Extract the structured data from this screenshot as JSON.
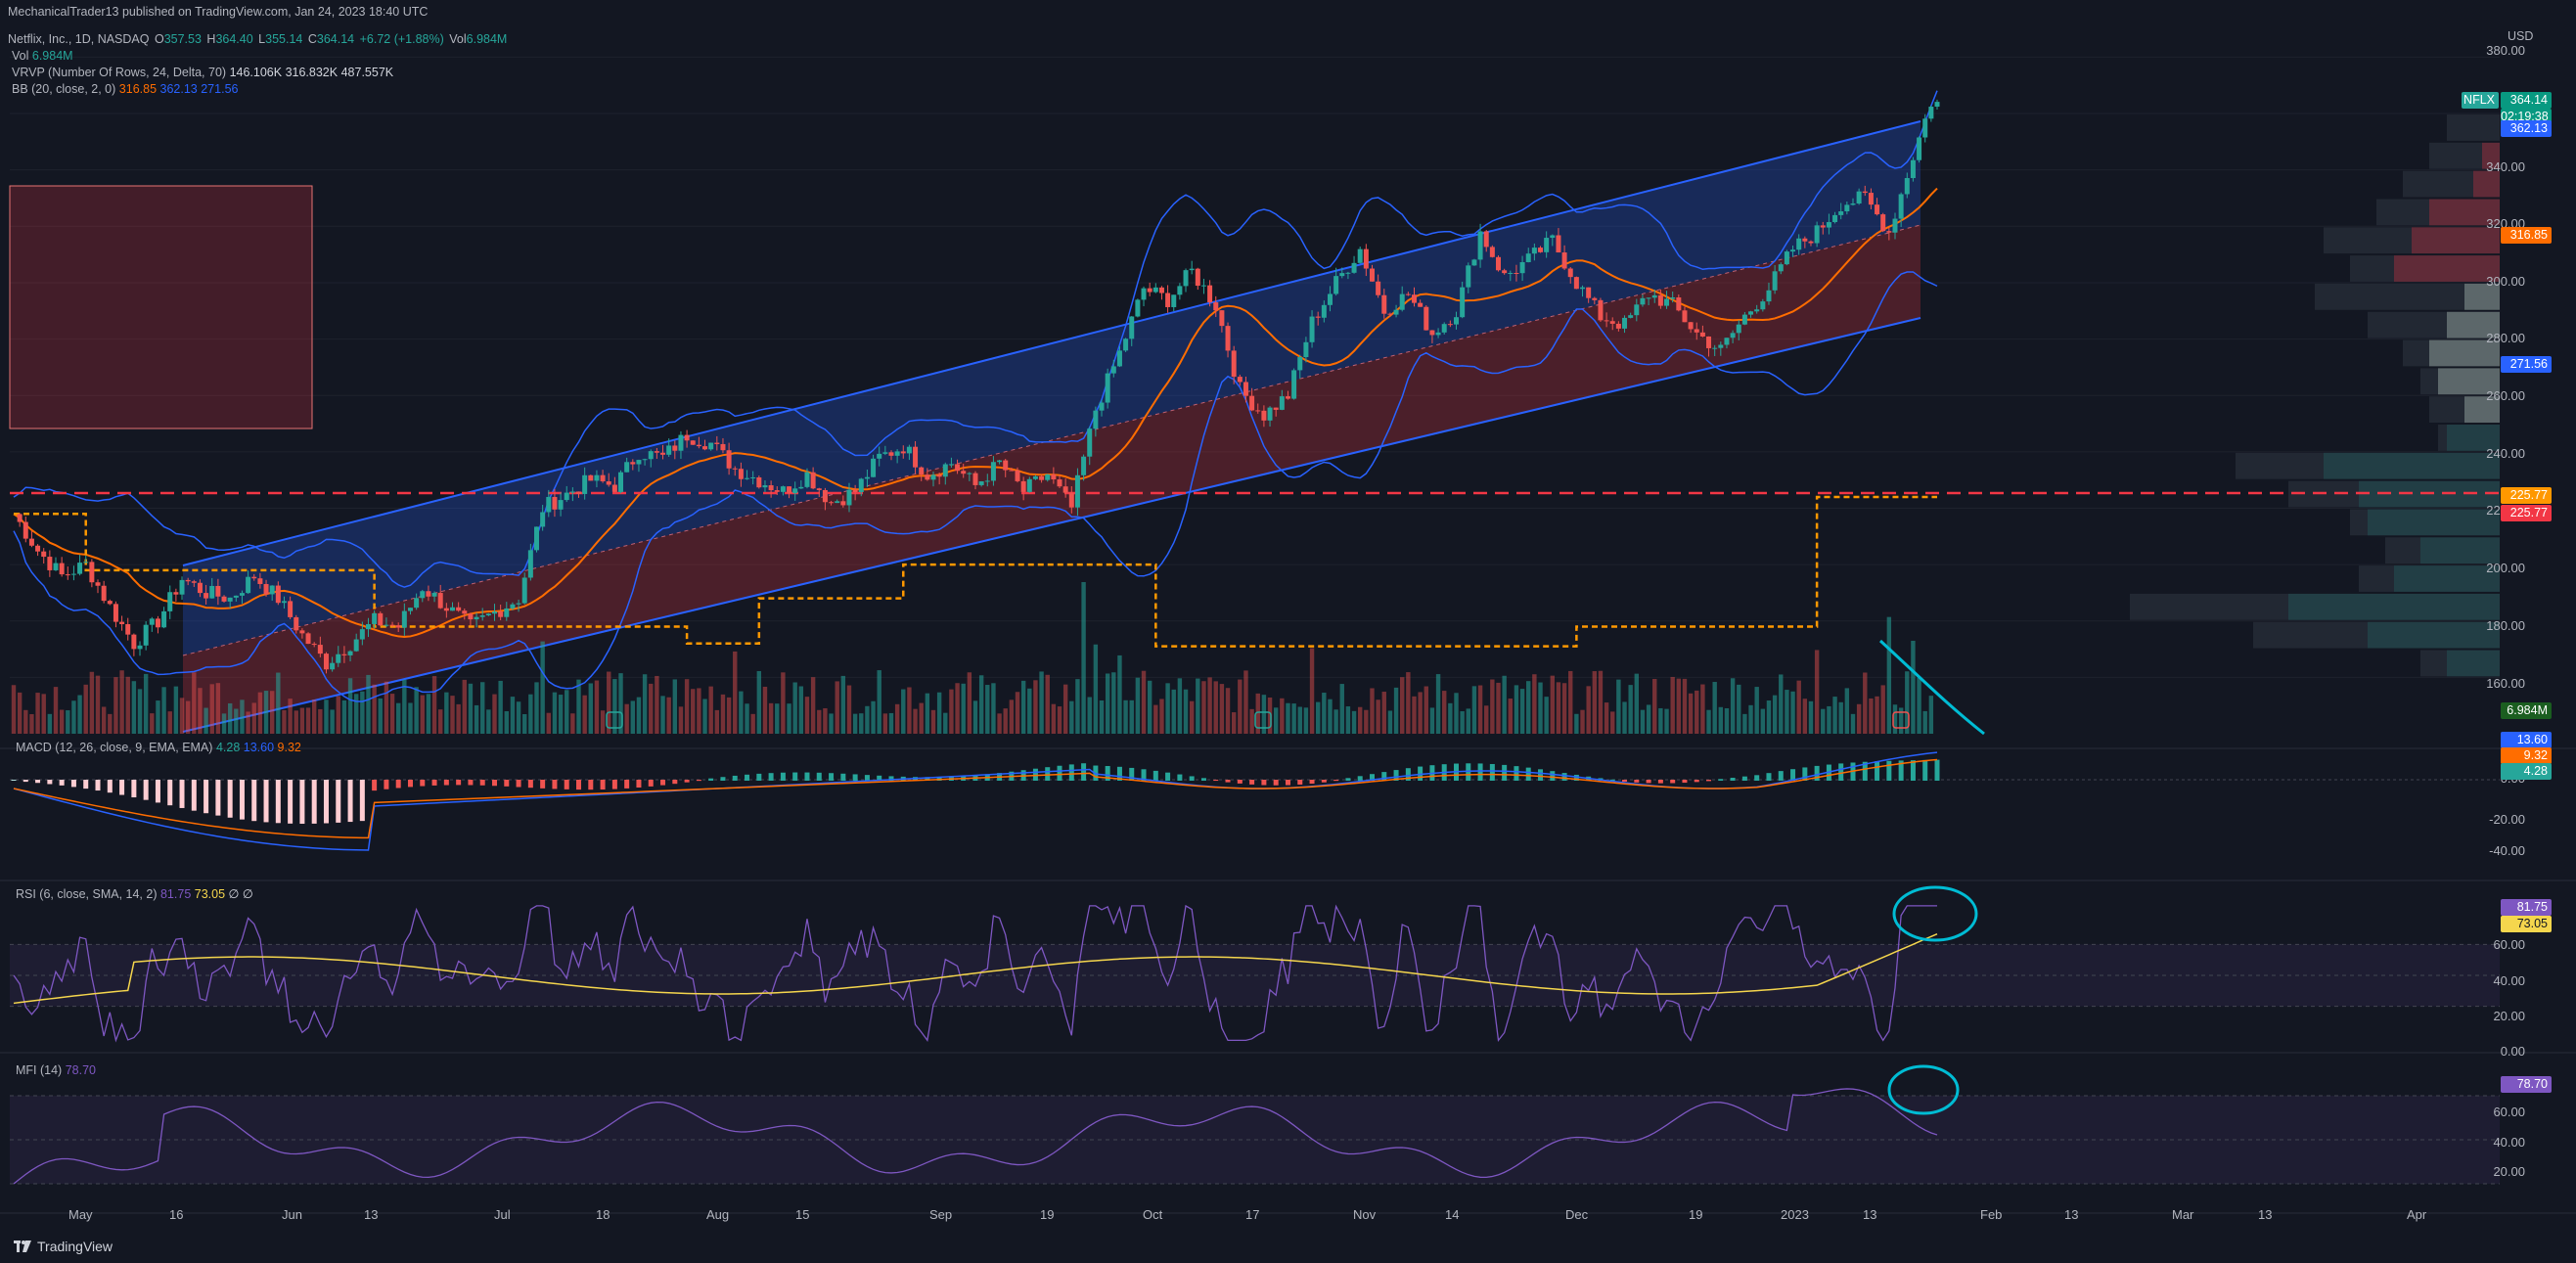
{
  "header": {
    "publisher": "MechanicalTrader13 published on TradingView.com, Jan 24, 2023 18:40 UTC",
    "symbol": "Netflix, Inc., 1D, NASDAQ",
    "open_label": "O",
    "open": "357.53",
    "high_label": "H",
    "high": "364.40",
    "low_label": "L",
    "low": "355.14",
    "close_label": "C",
    "close": "364.14",
    "change": "+6.72 (+1.88%)",
    "vol_label": "Vol",
    "vol": "6.984M"
  },
  "legends": {
    "vol_name": "Vol",
    "vol_value": "6.984M",
    "vrvp": "VRVP (Number Of Rows, 24, Delta, 70)",
    "vrvp_values": [
      "146.106K",
      "316.832K",
      "487.557K"
    ],
    "bb": "BB (20, close, 2, 0)",
    "bb_values": [
      "316.85",
      "362.13",
      "271.56"
    ]
  },
  "panes": {
    "macd_title": "MACD (12, 26, close, 9, EMA, EMA)",
    "macd_values": [
      "4.28",
      "13.60",
      "9.32"
    ],
    "rsi_title": "RSI (6, close, SMA, 14, 2)",
    "rsi_values": [
      "81.75",
      "73.05",
      "∅",
      "∅"
    ],
    "mfi_title": "MFI (14)",
    "mfi_value": "78.70"
  },
  "axis": {
    "currency": "USD",
    "price_ticks": [
      "380.00",
      "340.00",
      "320.00",
      "300.00",
      "280.00",
      "260.00",
      "240.00",
      "220.00",
      "200.00",
      "180.00",
      "160.00"
    ],
    "macd_ticks": [
      "0.00",
      "-20.00",
      "-40.00"
    ],
    "rsi_ticks": [
      "60.00",
      "40.00",
      "20.00",
      "0.00"
    ],
    "mfi_ticks": [
      "60.00",
      "40.00",
      "20.00"
    ],
    "time_ticks": [
      "May",
      "16",
      "Jun",
      "13",
      "Jul",
      "18",
      "Aug",
      "15",
      "Sep",
      "19",
      "Oct",
      "17",
      "Nov",
      "14",
      "Dec",
      "19",
      "2023",
      "13",
      "Feb",
      "13",
      "Mar",
      "13",
      "Apr"
    ]
  },
  "badges": {
    "symbol": "NFLX",
    "last_price": "364.14",
    "countdown": "02:19:38",
    "bb_upper": "362.13",
    "bb_basis": "316.85",
    "bb_lower": "271.56",
    "hline_1": "225.77",
    "hline_2": "225.77",
    "volume": "6.984M",
    "macd_1": "13.60",
    "macd_2": "9.32",
    "macd_3": "4.28",
    "rsi_1": "81.75",
    "rsi_2": "73.05",
    "mfi": "78.70"
  },
  "colors": {
    "background": "#131722",
    "up": "#26a69a",
    "down": "#ef5350",
    "bb_line": "#2962ff",
    "bb_basis": "#ff6d00",
    "channel_blue": "#2962ff",
    "channel_red": "#f23645",
    "rsi": "#7e57c2",
    "rsi_ma": "#f5d64d",
    "annotation": "#00bcd4"
  },
  "footer": {
    "brand": "TradingView"
  },
  "chart_data": {
    "type": "candlestick",
    "title": "Netflix, Inc., 1D, NASDAQ",
    "ylabel": "USD",
    "ylim": [
      140,
      385
    ],
    "price_path": [
      [
        0,
        218
      ],
      [
        4,
        205
      ],
      [
        8,
        196
      ],
      [
        12,
        200
      ],
      [
        16,
        185
      ],
      [
        20,
        172
      ],
      [
        24,
        180
      ],
      [
        28,
        195
      ],
      [
        32,
        190
      ],
      [
        36,
        188
      ],
      [
        40,
        196
      ],
      [
        44,
        188
      ],
      [
        48,
        175
      ],
      [
        52,
        165
      ],
      [
        56,
        172
      ],
      [
        60,
        180
      ],
      [
        64,
        178
      ],
      [
        68,
        192
      ],
      [
        72,
        185
      ],
      [
        76,
        178
      ],
      [
        80,
        183
      ],
      [
        84,
        188
      ],
      [
        88,
        220
      ],
      [
        92,
        225
      ],
      [
        96,
        230
      ],
      [
        100,
        228
      ],
      [
        104,
        240
      ],
      [
        108,
        238
      ],
      [
        112,
        246
      ],
      [
        116,
        243
      ],
      [
        120,
        234
      ],
      [
        124,
        230
      ],
      [
        128,
        226
      ],
      [
        132,
        232
      ],
      [
        136,
        222
      ],
      [
        140,
        226
      ],
      [
        144,
        238
      ],
      [
        148,
        242
      ],
      [
        152,
        232
      ],
      [
        156,
        236
      ],
      [
        160,
        228
      ],
      [
        164,
        236
      ],
      [
        168,
        226
      ],
      [
        172,
        232
      ],
      [
        176,
        220
      ],
      [
        180,
        255
      ],
      [
        184,
        275
      ],
      [
        188,
        298
      ],
      [
        192,
        294
      ],
      [
        196,
        304
      ],
      [
        200,
        292
      ],
      [
        204,
        262
      ],
      [
        208,
        253
      ],
      [
        212,
        260
      ],
      [
        216,
        286
      ],
      [
        220,
        300
      ],
      [
        224,
        312
      ],
      [
        228,
        290
      ],
      [
        232,
        296
      ],
      [
        236,
        282
      ],
      [
        240,
        290
      ],
      [
        244,
        318
      ],
      [
        248,
        302
      ],
      [
        252,
        308
      ],
      [
        256,
        315
      ],
      [
        260,
        300
      ],
      [
        264,
        288
      ],
      [
        268,
        285
      ],
      [
        272,
        296
      ],
      [
        276,
        292
      ],
      [
        280,
        282
      ],
      [
        284,
        276
      ],
      [
        288,
        288
      ],
      [
        292,
        298
      ],
      [
        296,
        312
      ],
      [
        300,
        318
      ],
      [
        304,
        328
      ],
      [
        308,
        330
      ],
      [
        312,
        318
      ],
      [
        316,
        345
      ],
      [
        319,
        364.14
      ]
    ],
    "bollinger": {
      "upper": 362.13,
      "basis": 316.85,
      "lower": 271.56
    },
    "horizontal_line": 225.77,
    "macd": {
      "macd": 13.6,
      "signal": 9.32,
      "histogram": 4.28
    },
    "rsi": {
      "value": 81.75,
      "ma": 73.05
    },
    "mfi": {
      "value": 78.7
    }
  }
}
